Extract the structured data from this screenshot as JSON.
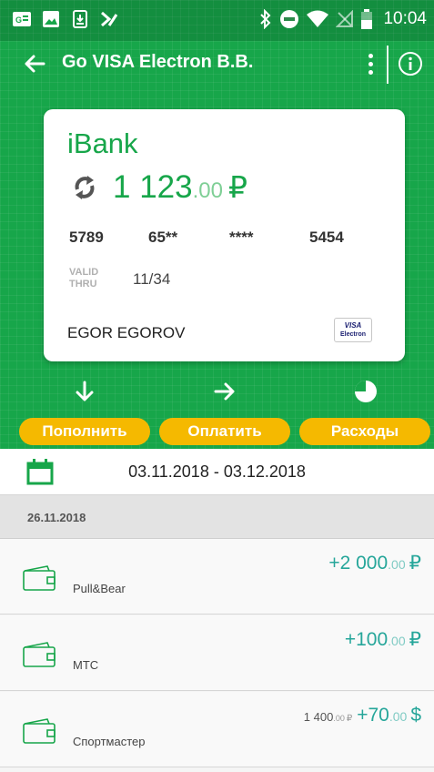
{
  "status_bar": {
    "time": "10:04",
    "left_icons": [
      "google-news-icon",
      "image-icon",
      "download-icon",
      "signature-app-icon"
    ],
    "right_icons": [
      "bluetooth-icon",
      "do-not-disturb-icon",
      "wifi-icon",
      "no-sim-icon",
      "battery-icon"
    ]
  },
  "toolbar": {
    "title": "Go VISA Electron B.B."
  },
  "card": {
    "bank_name": "iBank",
    "balance_int": "1 123",
    "balance_dec": ".00",
    "currency": "₽",
    "number_groups": [
      "5789",
      "65**",
      "****",
      "5454"
    ],
    "valid_label_1": "VALID",
    "valid_label_2": "THRU",
    "valid_thru": "11/34",
    "holder": "EGOR EGOROV",
    "brand_line_1": "VISA",
    "brand_line_2": "Electron"
  },
  "actions": [
    {
      "label": "Пополнить",
      "icon": "arrow-down-icon"
    },
    {
      "label": "Оплатить",
      "icon": "arrow-right-icon"
    },
    {
      "label": "Расходы",
      "icon": "pie-chart-icon"
    }
  ],
  "date_range": "03.11.2018 - 03.12.2018",
  "day": "26.11.2018",
  "transactions": [
    {
      "merchant": "Pull&Bear",
      "amount_int": "+2 000",
      "amount_dec": ".00",
      "currency": "₽"
    },
    {
      "merchant": "МТС",
      "amount_int": "+100",
      "amount_dec": ".00",
      "currency": "₽"
    },
    {
      "merchant": "Спортмастер",
      "orig_int": "1 400",
      "orig_dec": ".00",
      "orig_currency": "₽",
      "amount_int": "+70",
      "amount_dec": ".00",
      "currency": "$"
    }
  ],
  "colors": {
    "primary_green": "#17a64a",
    "accent_yellow": "#f5b900",
    "amount_teal": "#26a69a"
  }
}
